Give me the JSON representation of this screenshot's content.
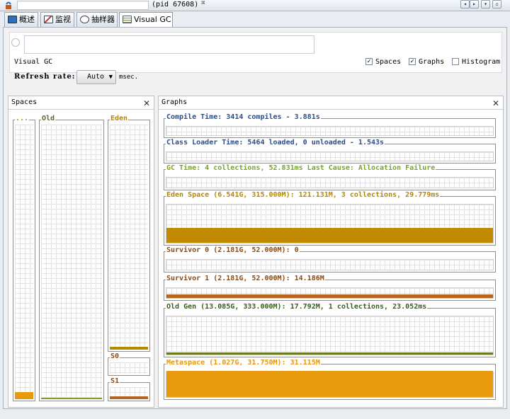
{
  "titlebar": {
    "pid_text": "(pid 67608)",
    "close_glyph": "⌘"
  },
  "tabs": [
    {
      "label": "概述",
      "icon": "overview-icon"
    },
    {
      "label": "监视",
      "icon": "monitor-icon"
    },
    {
      "label": "抽样器",
      "icon": "sampler-icon"
    },
    {
      "label": "Visual GC",
      "icon": "visual-gc-icon"
    }
  ],
  "header": {
    "title": "Visual GC",
    "options": [
      {
        "label": "Spaces",
        "checked": true
      },
      {
        "label": "Graphs",
        "checked": true
      },
      {
        "label": "Histogram",
        "checked": false
      }
    ],
    "refresh_label": "Refresh rate:",
    "refresh_value": "Auto",
    "refresh_unit": "msec."
  },
  "spaces_panel": {
    "title": "Spaces",
    "perm_label": "...",
    "old_label": "Old",
    "eden_label": "Eden",
    "s0_label": "S0",
    "s1_label": "S1"
  },
  "graphs_panel": {
    "title": "Graphs",
    "graphs": [
      {
        "label": "Compile Time: 3414 compiles - 3.881s",
        "color": "#2a4d8c"
      },
      {
        "label": "Class Loader Time: 5464 loaded, 0 unloaded - 1.543s",
        "color": "#2a4d8c"
      },
      {
        "label": "GC Time: 4 collections, 52.831ms Last Cause: Allocation Failure",
        "color": "#7aa32b"
      },
      {
        "label": "Eden Space (6.541G, 315.000M): 121.131M, 3 collections, 29.779ms",
        "color": "#b3860b"
      },
      {
        "label": "Survivor 0 (2.181G, 52.000M): 0",
        "color": "#8b4a14"
      },
      {
        "label": "Survivor 1 (2.181G, 52.000M): 14.186M",
        "color": "#8b4a14"
      },
      {
        "label": "Old Gen (13.085G, 333.000M): 17.792M, 1 collections, 23.052ms",
        "color": "#3c5a1e"
      },
      {
        "label": "Metaspace (1.027G, 31.750M): 31.115M",
        "color": "#e6960e"
      }
    ]
  },
  "colors": {
    "eden": "#b58900",
    "survivor": "#b5651d",
    "old": "#6b7a1f",
    "metaspace": "#e89a0e",
    "perm": "#e89a0e"
  },
  "fill_levels": {
    "perm": 0.98,
    "eden": 0.38,
    "s0": 0.0,
    "s1": 0.27,
    "old": 0.05,
    "metaspace": 0.98
  }
}
